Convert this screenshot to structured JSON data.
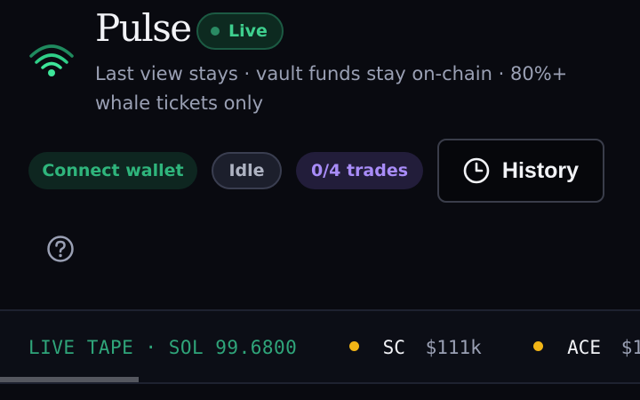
{
  "header": {
    "title": "Pulse",
    "status_badge": "Live",
    "tagline": "Last view stays · vault funds stay on-chain · 80%+ whale tickets only"
  },
  "status_bar": {
    "connect_wallet": "Connect wallet",
    "state": "Idle",
    "trades": "0/4 trades",
    "history_label": "History"
  },
  "tape": {
    "label": "LIVE TAPE · SOL 99.6800",
    "items": [
      {
        "symbol": "SC",
        "price": "$111k"
      },
      {
        "symbol": "ACE",
        "price": "$1"
      }
    ]
  },
  "icons": {
    "logo": "wifi-signal-icon",
    "history": "clock-icon",
    "help": "question-icon",
    "tape_marker": "dot-icon"
  },
  "colors": {
    "background": "#090a10",
    "accent_green": "#3ecf8e",
    "accent_purple": "#a88cf8",
    "tape_marker": "#f2b516"
  }
}
